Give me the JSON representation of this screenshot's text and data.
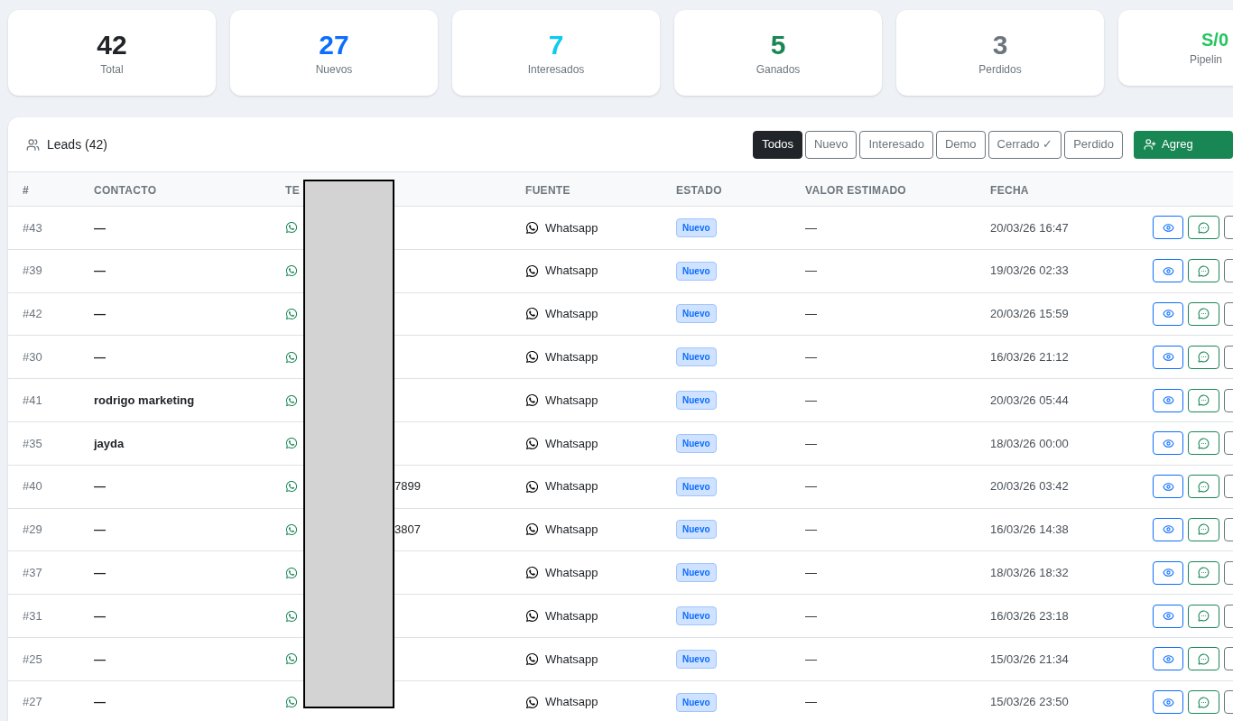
{
  "stats": [
    {
      "value": "42",
      "label": "Total",
      "color": "#212529"
    },
    {
      "value": "27",
      "label": "Nuevos",
      "color": "#0d6efd"
    },
    {
      "value": "7",
      "label": "Interesados",
      "color": "#0dcaf0"
    },
    {
      "value": "5",
      "label": "Ganados",
      "color": "#198754"
    },
    {
      "value": "3",
      "label": "Perdidos",
      "color": "#6c757d"
    },
    {
      "value": "S/0",
      "label": "Pipelin",
      "color": "#22c55e"
    }
  ],
  "panel": {
    "title": "Leads (42)",
    "filters": [
      {
        "label": "Todos",
        "selected": true
      },
      {
        "label": "Nuevo",
        "selected": false
      },
      {
        "label": "Interesado",
        "selected": false
      },
      {
        "label": "Demo",
        "selected": false
      },
      {
        "label": "Cerrado ✓",
        "selected": false
      },
      {
        "label": "Perdido",
        "selected": false
      }
    ],
    "add_button": "Agreg"
  },
  "table": {
    "columns": [
      "#",
      "CONTACTO",
      "TE",
      "FUENTE",
      "ESTADO",
      "VALOR ESTIMADO",
      "FECHA"
    ],
    "rows": [
      {
        "id": "#43",
        "contact": "—",
        "source": "Whatsapp",
        "status": "Nuevo",
        "value": "—",
        "date": "20/03/26 16:47"
      },
      {
        "id": "#39",
        "contact": "—",
        "source": "Whatsapp",
        "status": "Nuevo",
        "value": "—",
        "date": "19/03/26 02:33"
      },
      {
        "id": "#42",
        "contact": "—",
        "source": "Whatsapp",
        "status": "Nuevo",
        "value": "—",
        "date": "20/03/26 15:59"
      },
      {
        "id": "#30",
        "contact": "—",
        "source": "Whatsapp",
        "status": "Nuevo",
        "value": "—",
        "date": "16/03/26 21:12"
      },
      {
        "id": "#41",
        "contact": "rodrigo marketing",
        "source": "Whatsapp",
        "status": "Nuevo",
        "value": "—",
        "date": "20/03/26 05:44"
      },
      {
        "id": "#35",
        "contact": "jayda",
        "source": "Whatsapp",
        "status": "Nuevo",
        "value": "—",
        "date": "18/03/26 00:00"
      },
      {
        "id": "#40",
        "contact": "—",
        "phone_tail": "7899",
        "source": "Whatsapp",
        "status": "Nuevo",
        "value": "—",
        "date": "20/03/26 03:42"
      },
      {
        "id": "#29",
        "contact": "—",
        "phone_tail": "3807",
        "source": "Whatsapp",
        "status": "Nuevo",
        "value": "—",
        "date": "16/03/26 14:38"
      },
      {
        "id": "#37",
        "contact": "—",
        "source": "Whatsapp",
        "status": "Nuevo",
        "value": "—",
        "date": "18/03/26 18:32"
      },
      {
        "id": "#31",
        "contact": "—",
        "source": "Whatsapp",
        "status": "Nuevo",
        "value": "—",
        "date": "16/03/26 23:18"
      },
      {
        "id": "#25",
        "contact": "—",
        "source": "Whatsapp",
        "status": "Nuevo",
        "value": "—",
        "date": "15/03/26 21:34"
      },
      {
        "id": "#27",
        "contact": "—",
        "source": "Whatsapp",
        "status": "Nuevo",
        "value": "—",
        "date": "15/03/26 23:50"
      }
    ]
  }
}
